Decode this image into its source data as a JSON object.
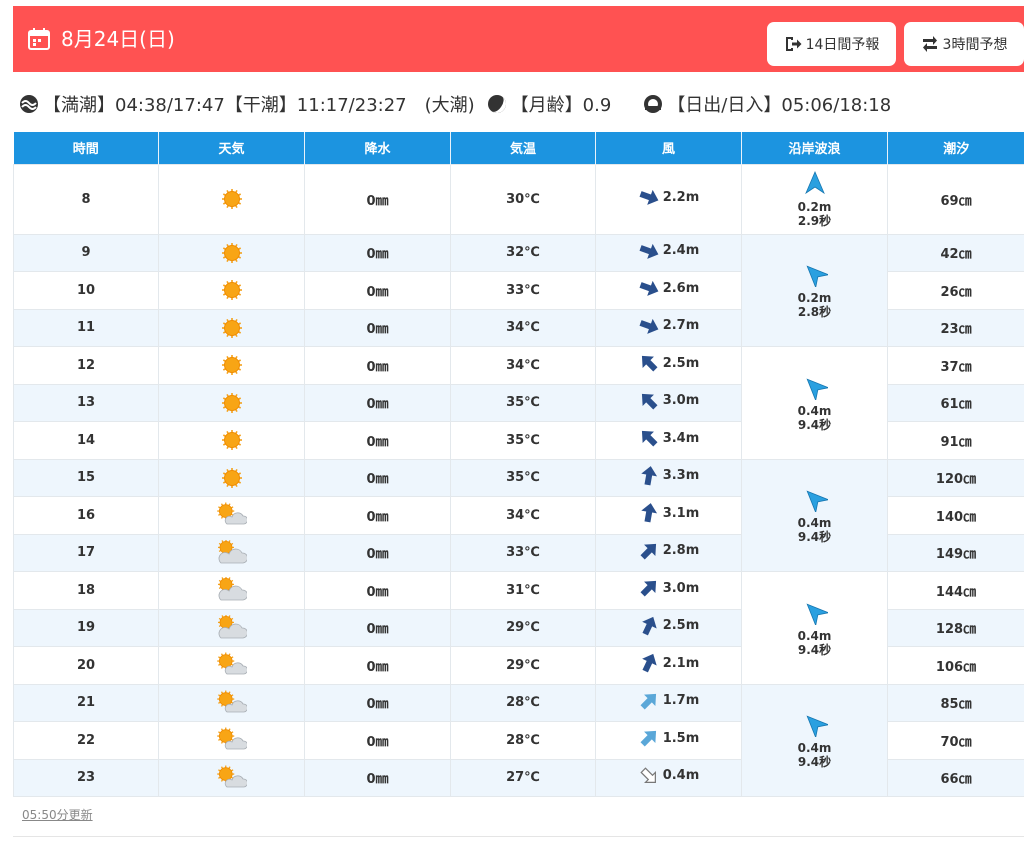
{
  "header": {
    "date": "8月24日(日)",
    "btn_14day": "14日間予報",
    "btn_3hour": "3時間予想"
  },
  "info": {
    "high_tide": "【満潮】04:38/17:47",
    "low_tide": "【干潮】11:17/23:27",
    "tide_type": "(大潮)",
    "moon_age": "【月齢】0.9",
    "sun": "【日出/日入】05:06/18:18"
  },
  "table": {
    "headers": [
      "時間",
      "天気",
      "降水",
      "気温",
      "風",
      "沿岸波浪",
      "潮汐"
    ],
    "rows": [
      {
        "hour": "8",
        "weather": "sunny-icon",
        "precip": "0㎜",
        "temp": "30℃",
        "wind_dir": "ene",
        "wind_strength": "strong",
        "wind": "2.2m",
        "tide": "69㎝"
      },
      {
        "hour": "9",
        "weather": "sunny-icon",
        "precip": "0㎜",
        "temp": "32℃",
        "wind_dir": "ene",
        "wind_strength": "strong",
        "wind": "2.4m",
        "tide": "42㎝"
      },
      {
        "hour": "10",
        "weather": "sunny-icon",
        "precip": "0㎜",
        "temp": "33℃",
        "wind_dir": "ene",
        "wind_strength": "strong",
        "wind": "2.6m",
        "tide": "26㎝"
      },
      {
        "hour": "11",
        "weather": "sunny-icon",
        "precip": "0㎜",
        "temp": "34℃",
        "wind_dir": "ene",
        "wind_strength": "strong",
        "wind": "2.7m",
        "tide": "23㎝"
      },
      {
        "hour": "12",
        "weather": "sunny-icon",
        "precip": "0㎜",
        "temp": "34℃",
        "wind_dir": "nw",
        "wind_strength": "strong",
        "wind": "2.5m",
        "tide": "37㎝"
      },
      {
        "hour": "13",
        "weather": "sunny-icon",
        "precip": "0㎜",
        "temp": "35℃",
        "wind_dir": "nw",
        "wind_strength": "strong",
        "wind": "3.0m",
        "tide": "61㎝"
      },
      {
        "hour": "14",
        "weather": "sunny-icon",
        "precip": "0㎜",
        "temp": "35℃",
        "wind_dir": "nw",
        "wind_strength": "strong",
        "wind": "3.4m",
        "tide": "91㎝"
      },
      {
        "hour": "15",
        "weather": "sunny-icon",
        "precip": "0㎜",
        "temp": "35℃",
        "wind_dir": "n",
        "wind_strength": "strong",
        "wind": "3.3m",
        "tide": "120㎝"
      },
      {
        "hour": "16",
        "weather": "sun-cloud-icon",
        "precip": "0㎜",
        "temp": "34℃",
        "wind_dir": "n",
        "wind_strength": "strong",
        "wind": "3.1m",
        "tide": "140㎝"
      },
      {
        "hour": "17",
        "weather": "cloud-sun-icon",
        "precip": "0㎜",
        "temp": "33℃",
        "wind_dir": "ne",
        "wind_strength": "strong",
        "wind": "2.8m",
        "tide": "149㎝"
      },
      {
        "hour": "18",
        "weather": "cloud-sun-icon",
        "precip": "0㎜",
        "temp": "31℃",
        "wind_dir": "ne",
        "wind_strength": "strong",
        "wind": "3.0m",
        "tide": "144㎝"
      },
      {
        "hour": "19",
        "weather": "cloud-sun-icon",
        "precip": "0㎜",
        "temp": "29℃",
        "wind_dir": "nne",
        "wind_strength": "strong",
        "wind": "2.5m",
        "tide": "128㎝"
      },
      {
        "hour": "20",
        "weather": "sun-cloud-icon",
        "precip": "0㎜",
        "temp": "29℃",
        "wind_dir": "nne",
        "wind_strength": "strong",
        "wind": "2.1m",
        "tide": "106㎝"
      },
      {
        "hour": "21",
        "weather": "sun-cloud-icon",
        "precip": "0㎜",
        "temp": "28℃",
        "wind_dir": "ne",
        "wind_strength": "light",
        "wind": "1.7m",
        "tide": "85㎝"
      },
      {
        "hour": "22",
        "weather": "sun-cloud-icon",
        "precip": "0㎜",
        "temp": "28℃",
        "wind_dir": "ne",
        "wind_strength": "light",
        "wind": "1.5m",
        "tide": "70㎝"
      },
      {
        "hour": "23",
        "weather": "sun-cloud-icon",
        "precip": "0㎜",
        "temp": "27℃",
        "wind_dir": "se",
        "wind_strength": "calm",
        "wind": "0.4m",
        "tide": "66㎝"
      }
    ],
    "waves": [
      {
        "height": "0.2m",
        "period": "2.9秒",
        "dir": "n"
      },
      {
        "height": "0.2m",
        "period": "2.8秒",
        "dir": "nw"
      },
      {
        "height": "0.4m",
        "period": "9.4秒",
        "dir": "nw"
      },
      {
        "height": "0.4m",
        "period": "9.4秒",
        "dir": "nw"
      },
      {
        "height": "0.4m",
        "period": "9.4秒",
        "dir": "nw"
      },
      {
        "height": "0.4m",
        "period": "9.4秒",
        "dir": "nw"
      }
    ]
  },
  "footer": {
    "updated": "05:50分更新"
  },
  "colors": {
    "header_bg": "#ff5252",
    "table_header_bg": "#1c94e0",
    "alt_row_bg": "#eef6fd",
    "wind_strong": "#2a4f8c",
    "wind_light": "#5aa7d8",
    "wave_arrow": "#2aa0e0"
  }
}
